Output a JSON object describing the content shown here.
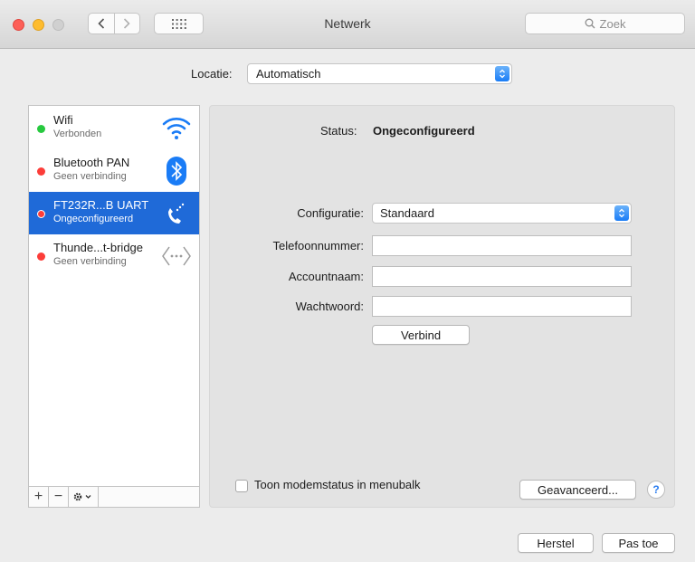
{
  "window": {
    "title": "Netwerk",
    "search_placeholder": "Zoek"
  },
  "location": {
    "label": "Locatie:",
    "value": "Automatisch"
  },
  "services": [
    {
      "name": "Wifi",
      "status": "Verbonden",
      "dot_color": "#27c93f",
      "icon": "wifi-icon",
      "selected": false
    },
    {
      "name": "Bluetooth PAN",
      "status": "Geen verbinding",
      "dot_color": "#fc3d39",
      "icon": "bluetooth-icon",
      "selected": false
    },
    {
      "name": "FT232R...B UART",
      "status": "Ongeconfigureerd",
      "dot_color": "#fc3d39",
      "icon": "phone-icon",
      "selected": true
    },
    {
      "name": "Thunde...t-bridge",
      "status": "Geen verbinding",
      "dot_color": "#fc3d39",
      "icon": "thunderbolt-bridge-icon",
      "selected": false
    }
  ],
  "sidebar_footer": {
    "add": "+",
    "remove": "−"
  },
  "detail": {
    "status_label": "Status:",
    "status_value": "Ongeconfigureerd",
    "config_label": "Configuratie:",
    "config_value": "Standaard",
    "phone_label": "Telefoonnummer:",
    "account_label": "Accountnaam:",
    "password_label": "Wachtwoord:",
    "phone_value": "",
    "account_value": "",
    "password_value": "",
    "connect_button": "Verbind",
    "modem_checkbox_label": "Toon modemstatus in menubalk",
    "modem_checkbox_checked": false,
    "advanced_button": "Geavanceerd...",
    "help_button": "?"
  },
  "footer": {
    "revert_button": "Herstel",
    "apply_button": "Pas toe"
  },
  "colors": {
    "selection": "#1f6ad8",
    "accent": "#1a7cf6"
  }
}
